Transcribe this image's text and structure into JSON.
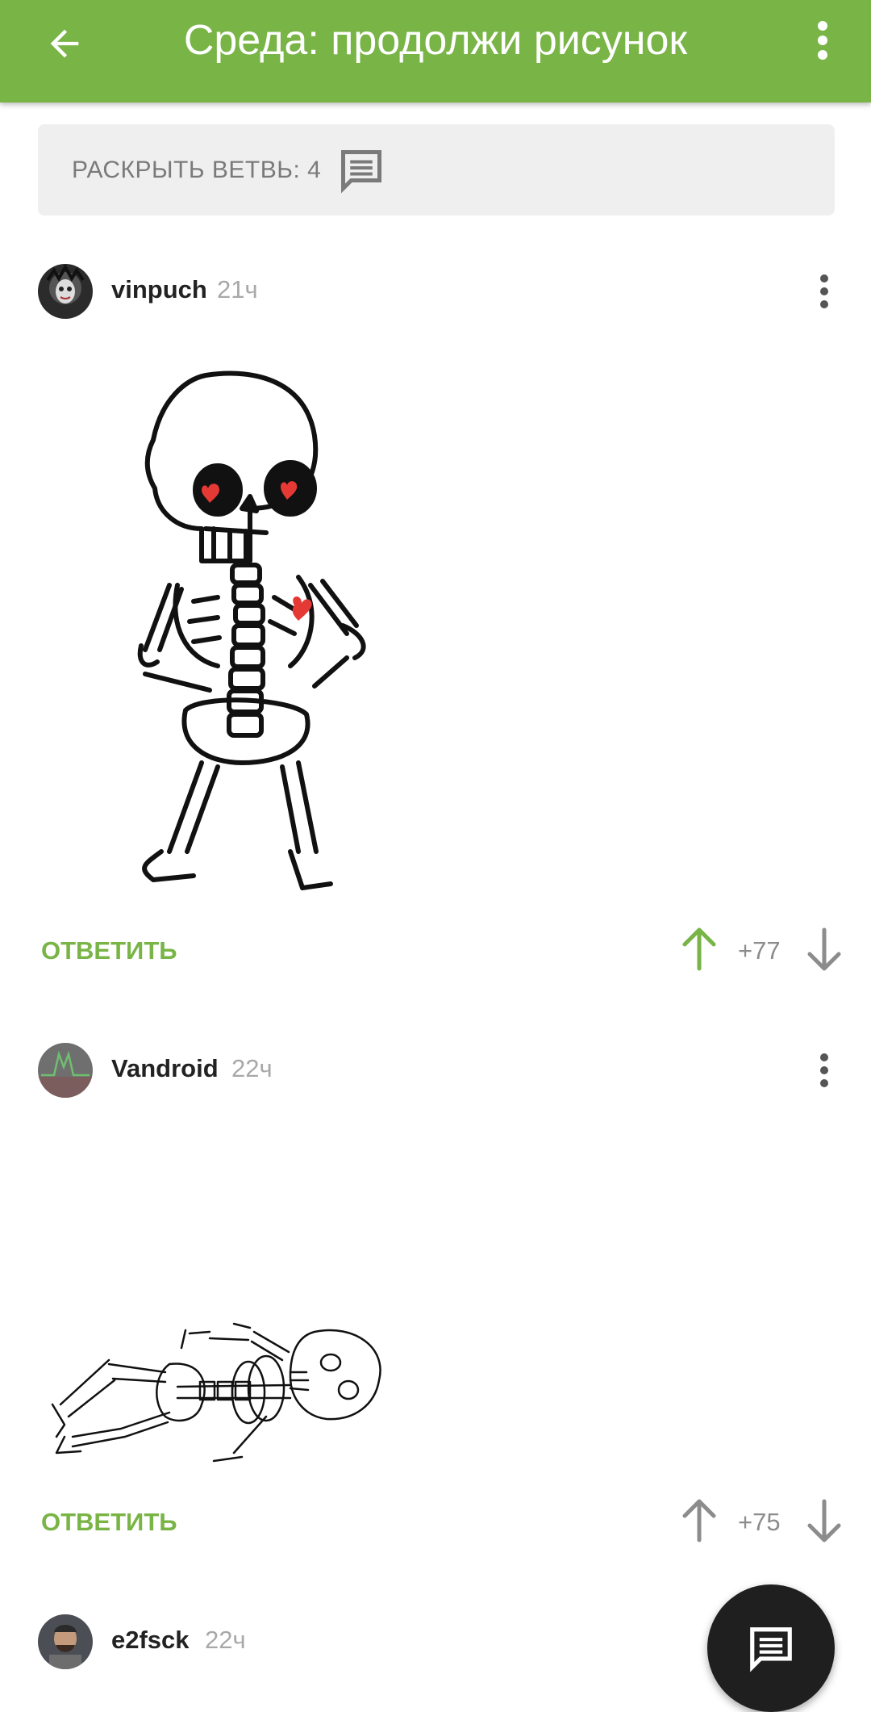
{
  "appbar": {
    "title": "Среда: продолжи рисунок",
    "back_icon": "arrow-left-icon",
    "more_icon": "more-vert-icon"
  },
  "thread": {
    "expand_label": "РАСКРЫТЬ ВЕТВЬ: 4",
    "expand_icon": "comment-icon"
  },
  "comments": [
    {
      "author": "vinpuch",
      "time": "21ч",
      "reply_label": "ОТВЕТИТЬ",
      "score": "+77",
      "voted_up": true
    },
    {
      "author": "Vandroid",
      "time": "22ч",
      "reply_label": "ОТВЕТИТЬ",
      "score": "+75",
      "voted_up": false
    },
    {
      "author": "e2fsck",
      "time": "22ч"
    }
  ],
  "colors": {
    "accent": "#79b446",
    "muted": "#8c8c8c",
    "fab": "#1f1f1f"
  },
  "fab": {
    "icon": "comment-icon"
  }
}
